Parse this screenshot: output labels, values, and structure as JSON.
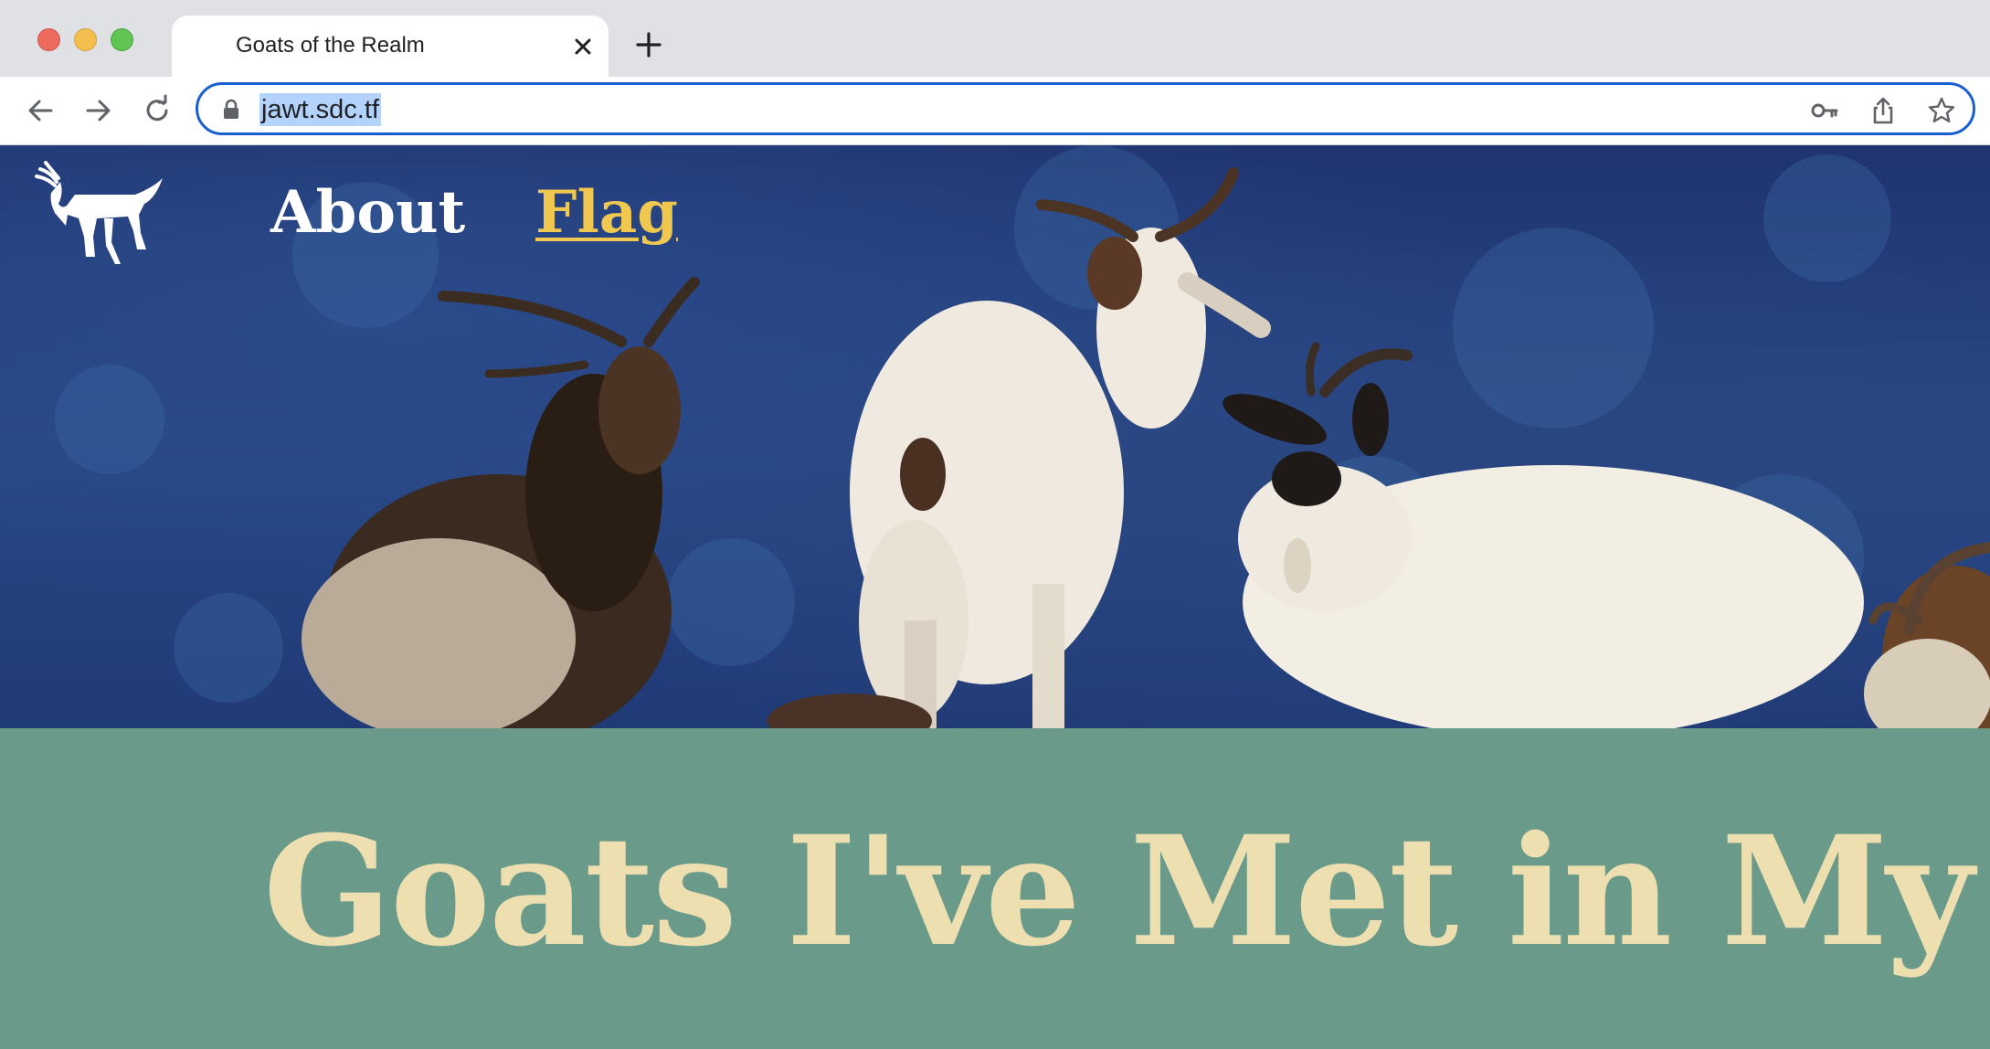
{
  "browser": {
    "tab_title": "Goats of the Realm",
    "url": "jawt.sdc.tf",
    "icons": [
      "close-icon",
      "plus-icon",
      "back-arrow-icon",
      "forward-arrow-icon",
      "reload-icon",
      "lock-icon",
      "key-icon",
      "share-icon",
      "star-icon"
    ]
  },
  "site": {
    "nav": {
      "about_label": "About",
      "flag_label": "Flag"
    },
    "headline": "Goats I've Met in My Tra",
    "colors": {
      "banner_bg": "#6a9a8a",
      "headline": "#eddfb0",
      "active_link": "#f0c850"
    }
  }
}
